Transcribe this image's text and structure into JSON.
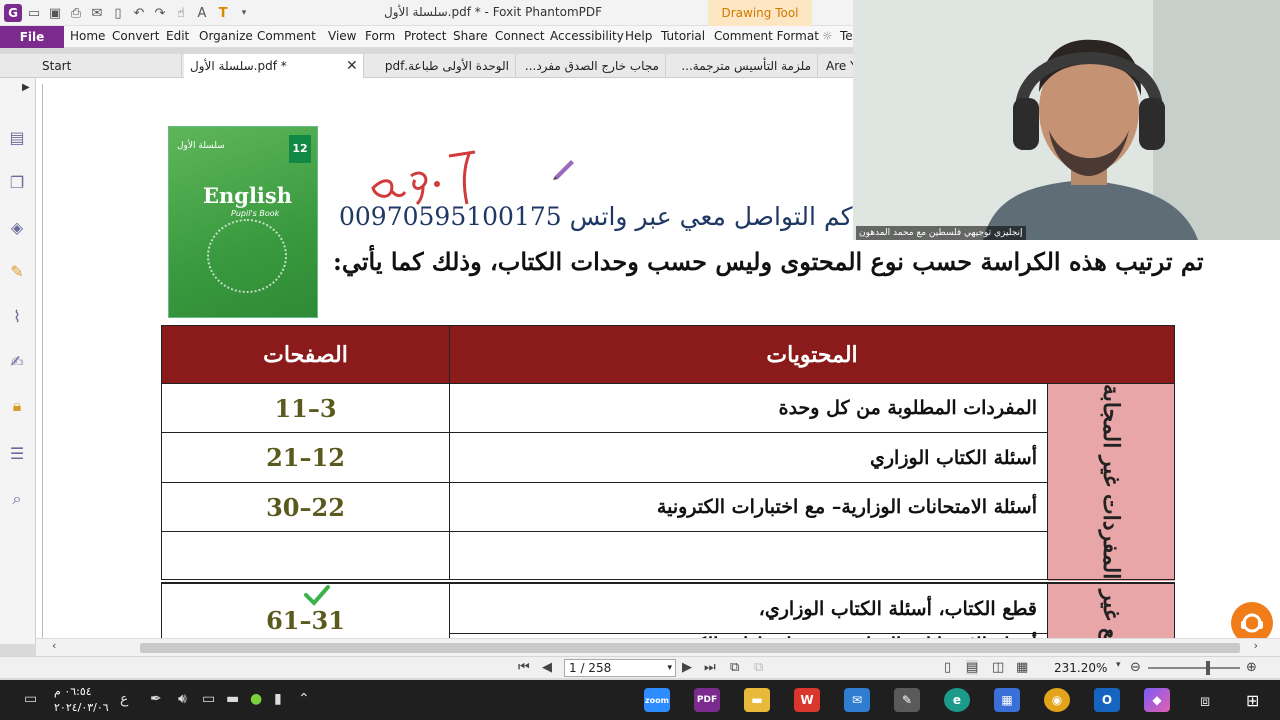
{
  "window": {
    "title": "سلسلة الأول.pdf * - Foxit PhantomPDF",
    "contextual_tab": "Drawing Tool"
  },
  "menu": {
    "file": "File",
    "items": [
      "Home",
      "Convert",
      "Edit",
      "Organize",
      "Comment",
      "View",
      "Form",
      "Protect",
      "Share",
      "Connect",
      "Accessibility",
      "Help",
      "Tutorial",
      "Comment Format",
      "Te"
    ]
  },
  "tabs": {
    "items": [
      "Start",
      "سلسلة الأول.pdf *",
      "الوحدة الأولى طباعة.pdf",
      "مجاب خارج الصدق مفرد...",
      "ملزمة التأسيس مترجمة...",
      "Are Y"
    ],
    "close_glyph": "✕"
  },
  "cover": {
    "top_text": "سلسلة الأول",
    "grade": "12",
    "title": "English",
    "subtitle": "Pupil's Book"
  },
  "document": {
    "handwriting": "٩٠٩٦",
    "contact_line": "كم التواصل معي عبر واتس 00970595100175",
    "heading": "تم ترتيب هذه الكراسة حسب نوع المحتوى وليس حسب وحدات الكتاب، وذلك كما يأتي:",
    "table": {
      "headers": {
        "contents": "المحتويات",
        "pages": "الصفحات"
      },
      "groups": [
        {
          "category": "المفردات غير المجابة",
          "rows": [
            {
              "item": "المفردات المطلوبة من كل وحدة",
              "pages": "11–3"
            },
            {
              "item": "أسئلة الكتاب الوزاري",
              "pages": "21–12"
            },
            {
              "item": "أسئلة الامتحانات الوزارية– مع اختبارات الكترونية",
              "pages": "30–22"
            },
            {
              "item": "",
              "pages": ""
            }
          ]
        },
        {
          "category": "قطع غير",
          "rows": [
            {
              "item": "قطع الكتاب، أسئلة الكتاب الوزاري،",
              "pages": "61–31"
            },
            {
              "item": "أسئلة الامتحانات الوزارية – مع اختبارات الكترونية",
              "pages": ""
            }
          ]
        }
      ]
    }
  },
  "statusbar": {
    "page_indicator": "1 / 258",
    "zoom": "231.20%"
  },
  "taskbar": {
    "time": "٠٦:٥٤ م",
    "date": "٢٠٢٤/٠٣/٠٦",
    "lang": "ع",
    "apps": [
      "zoom",
      "PDF",
      "files",
      "wps",
      "mail",
      "paint",
      "edge",
      "store",
      "chrome",
      "outlook",
      "copilot"
    ]
  },
  "webcam": {
    "caption": "إنجليزي توجيهي فلسطين مع محمد المدهون"
  },
  "colors": {
    "accent": "#7b2b8e",
    "table_header": "#8b1a1a",
    "category_fill": "#e8a6a8",
    "contact_text": "#1f3864",
    "page_numbers": "#5a5a1f"
  }
}
